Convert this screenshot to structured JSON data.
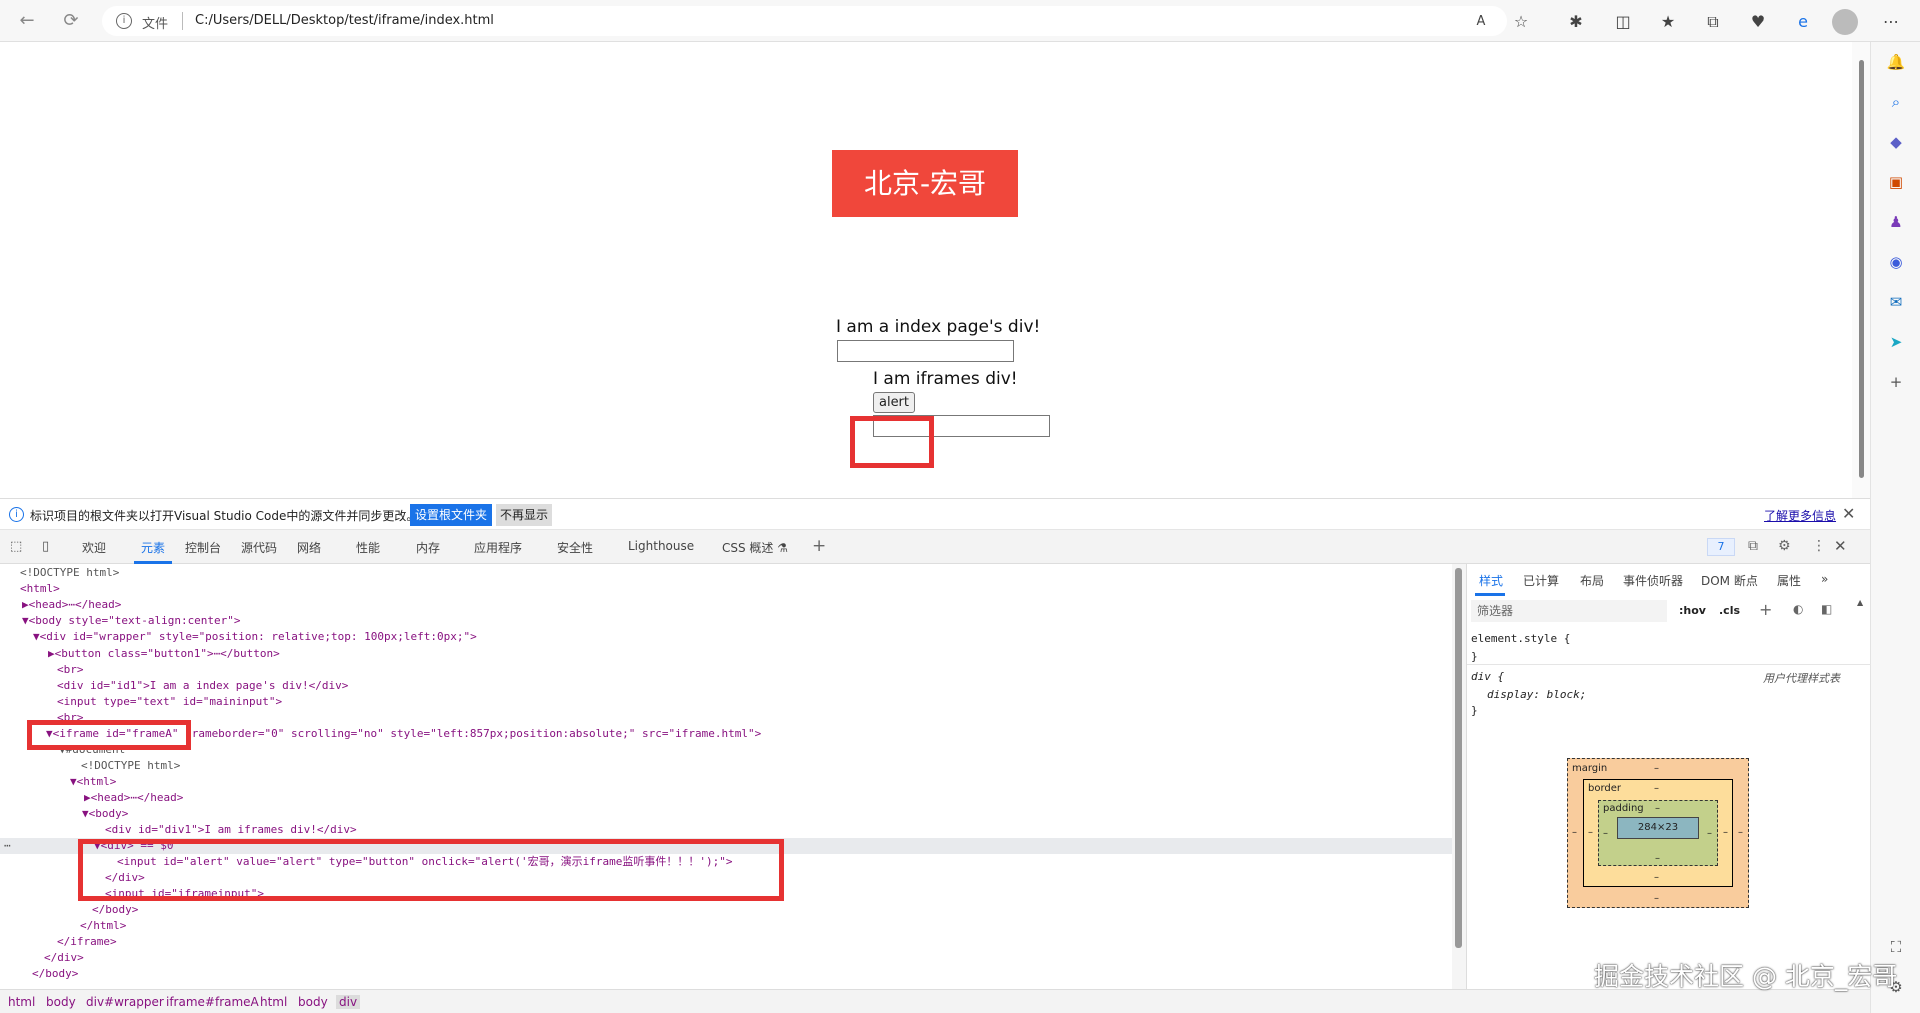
{
  "browser": {
    "url_label": "文件",
    "url": "C:/Users/DELL/Desktop/test/iframe/index.html"
  },
  "page": {
    "brand_button": "北京-宏哥",
    "index_div_text": "I am a index page's div!",
    "iframe_div_text": "I am iframes div!",
    "alert_button": "alert"
  },
  "infobar": {
    "message": "标识项目的根文件夹以打开Visual Studio Code中的源文件并同步更改。",
    "set_root_button": "设置根文件夹",
    "dismiss_button": "不再显示",
    "learn_more_link": "了解更多信息"
  },
  "devtools": {
    "tabs": [
      "欢迎",
      "元素",
      "控制台",
      "源代码",
      "网络",
      "性能",
      "内存",
      "应用程序",
      "安全性",
      "Lighthouse",
      "CSS 概述 ⚗"
    ],
    "issues_count": "7",
    "dom_lines": [
      "<!DOCTYPE html>",
      "<html>",
      "▶<head>⋯</head>",
      "▼<body style=\"text-align:center\">",
      "▼<div id=\"wrapper\" style=\"position: relative;top: 100px;left:0px;\">",
      "▶<button class=\"button1\">⋯</button>",
      "<br>",
      "<div id=\"id1\">I am a index page's div!</div>",
      "<input type=\"text\" id=\"maininput\">",
      "<br>",
      "▼<iframe id=\"frameA\" frameborder=\"0\" scrolling=\"no\" style=\"left:857px;position:absolute;\" src=\"iframe.html\">",
      "▼#document",
      "<!DOCTYPE html>",
      "▼<html>",
      "▶<head>⋯</head>",
      "▼<body>",
      "<div id=\"div1\">I am iframes div!</div>",
      "▼<div> == $0",
      "<input id=\"alert\" value=\"alert\" type=\"button\" onclick=\"alert('宏哥，演示iframe监听事件！！！');\">",
      "</div>",
      "<input id=\"iframeinput\">",
      "</body>",
      "</html>",
      "</iframe>",
      "</div>",
      "</body>"
    ],
    "styles_tabs": [
      "样式",
      "已计算",
      "布局",
      "事件侦听器",
      "DOM 断点",
      "属性",
      "»"
    ],
    "filter_placeholder": "筛选器",
    "hov": ":hov",
    "cls": ".cls",
    "element_style": "element.style {",
    "close_brace": "}",
    "div_selector": "div {",
    "ua_label": "用户代理样式表",
    "display_rule": "display: block;",
    "boxmodel": {
      "margin_label": "margin",
      "border_label": "border",
      "padding_label": "padding",
      "content": "284×23",
      "dash": "–"
    },
    "breadcrumbs": [
      "html",
      "body",
      "div#wrapper",
      "iframe#frameA",
      "html",
      "body",
      "div"
    ]
  },
  "watermark": "掘金技术社区 @ 北京_宏哥",
  "colors": {
    "brand_red": "#f0473b",
    "highlight_red": "#e63232",
    "devtools_blue": "#1a73e8"
  }
}
